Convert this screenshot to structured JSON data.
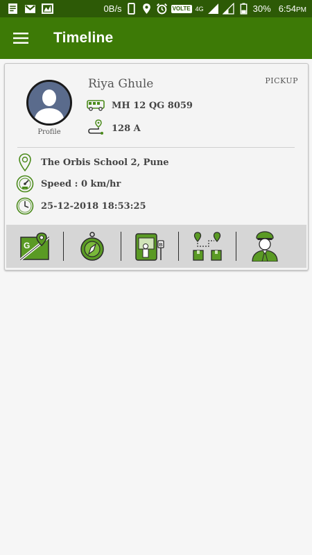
{
  "status_bar": {
    "speed": "0B/s",
    "network": "4G",
    "volte": "VOLTE",
    "battery": "30%",
    "time": "6:54",
    "ampm": "PM"
  },
  "app_bar": {
    "title": "Timeline",
    "menu_icon": "hamburger-menu-icon"
  },
  "colors": {
    "status_bar": "#2d5a06",
    "app_bar": "#3d7a06",
    "accent_green": "#4a8a1a",
    "text": "#444444"
  },
  "card": {
    "profile_label": "Profile",
    "name": "Riya Ghule",
    "trip_type": "PICKUP",
    "vehicle_number": "MH 12 QG 8059",
    "route": "128 A",
    "location": "The Orbis School 2, Pune",
    "speed": "Speed : 0 km/hr",
    "datetime": "25-12-2018 18:53:25"
  },
  "actions": [
    {
      "icon": "map-icon"
    },
    {
      "icon": "compass-icon"
    },
    {
      "icon": "bus-stop-icon"
    },
    {
      "icon": "route-packages-icon"
    },
    {
      "icon": "driver-icon"
    }
  ]
}
